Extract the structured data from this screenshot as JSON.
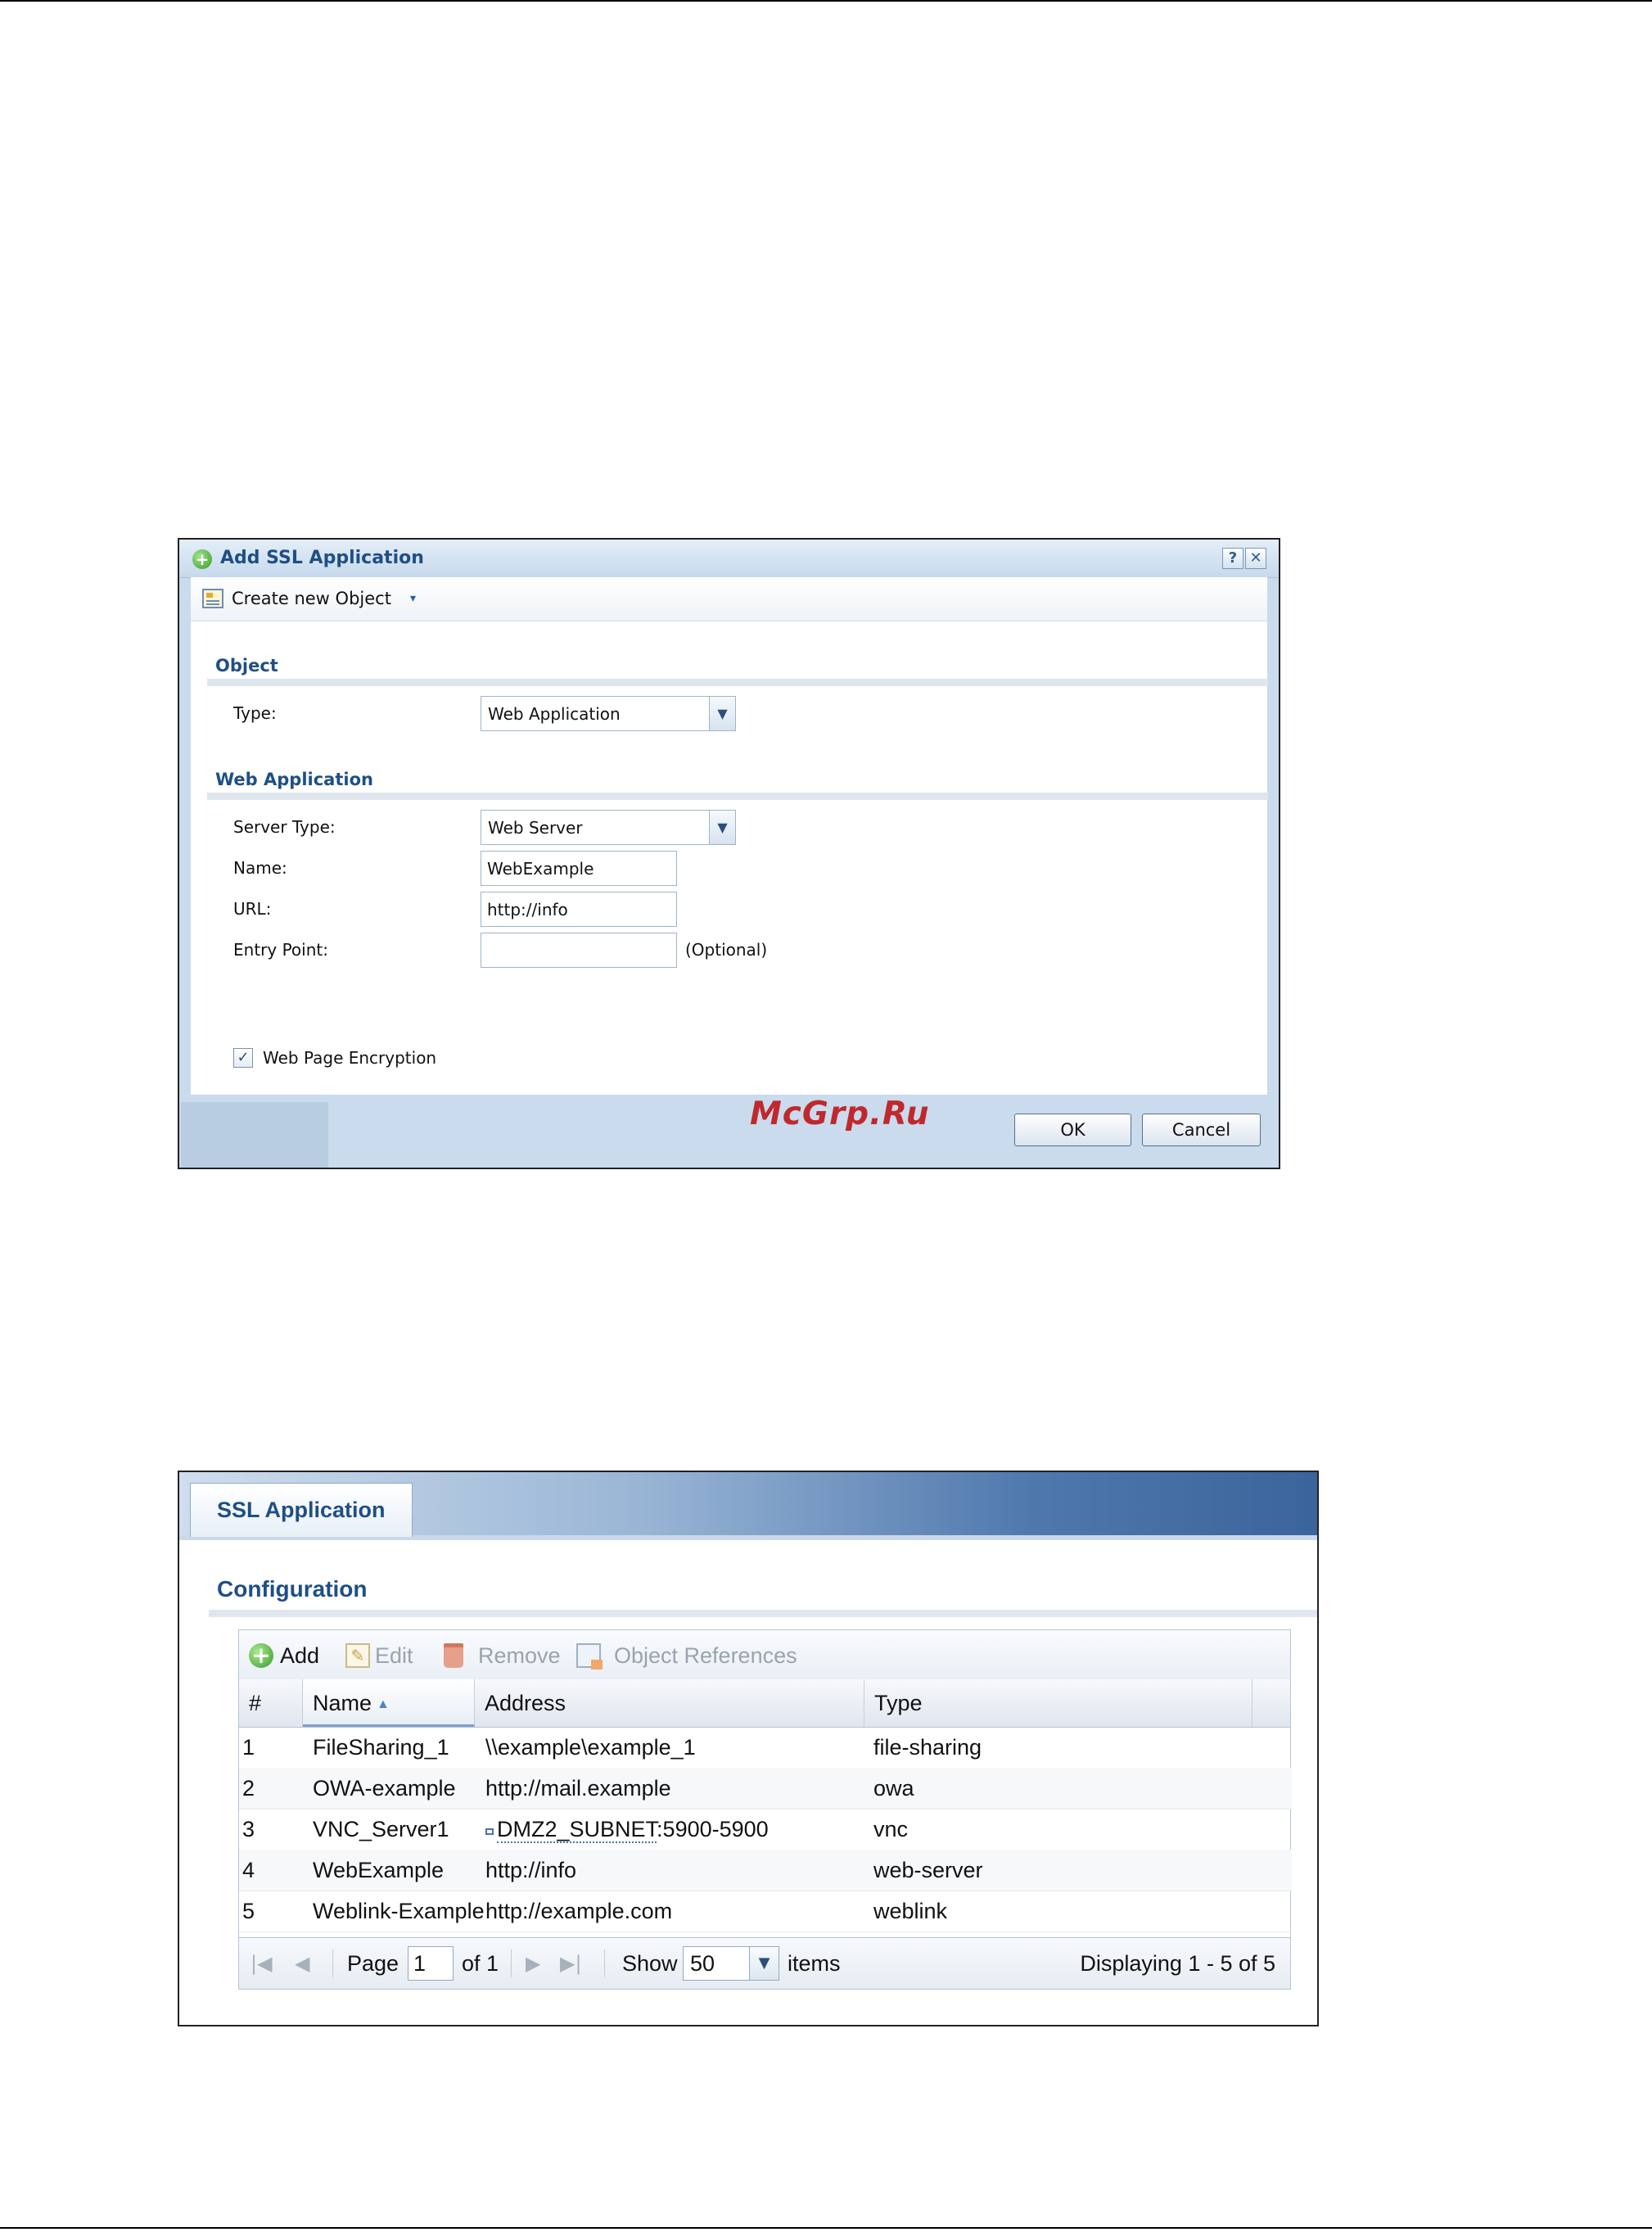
{
  "dialog": {
    "title": "Add SSL Application",
    "help_glyph": "?",
    "close_glyph": "✕",
    "create_label": "Create new Object",
    "create_caret": "▾",
    "object_section": "Object",
    "type_label": "Type:",
    "type_value": "Web Application",
    "web_section": "Web Application",
    "server_type_label": "Server Type:",
    "server_type_value": "Web Server",
    "name_label": "Name:",
    "name_value": "WebExample",
    "url_label": "URL:",
    "url_value": "http://info",
    "entry_label": "Entry Point:",
    "entry_value": "",
    "optional_label": "(Optional)",
    "encryption_label": "Web Page Encryption",
    "encryption_checked": true,
    "ok_label": "OK",
    "cancel_label": "Cancel"
  },
  "watermark": "McGrp.Ru",
  "panel": {
    "tab_label": "SSL Application",
    "section_title": "Configuration",
    "toolbar": {
      "add": "Add",
      "edit": "Edit",
      "remove": "Remove",
      "references": "Object References"
    },
    "columns": [
      "#",
      "Name",
      "Address",
      "Type"
    ],
    "sort_indicator": "▲",
    "rows": [
      {
        "num": "1",
        "name": "FileSharing_1",
        "address": "\\\\example\\example_1",
        "type": "file-sharing"
      },
      {
        "num": "2",
        "name": "OWA-example",
        "address": "http://mail.example",
        "type": "owa"
      },
      {
        "num": "3",
        "name": "VNC_Server1",
        "address": "DMZ2_SUBNET",
        "address_suffix": ":5900-5900",
        "type": "vnc"
      },
      {
        "num": "4",
        "name": "WebExample",
        "address": "http://info",
        "type": "web-server"
      },
      {
        "num": "5",
        "name": "Weblink-Example",
        "address": "http://example.com",
        "type": "weblink"
      }
    ],
    "pager": {
      "page_label": "Page",
      "page_value": "1",
      "of_label": "of 1",
      "show_label": "Show",
      "show_value": "50",
      "items_label": "items",
      "displaying": "Displaying 1 - 5 of 5"
    }
  }
}
